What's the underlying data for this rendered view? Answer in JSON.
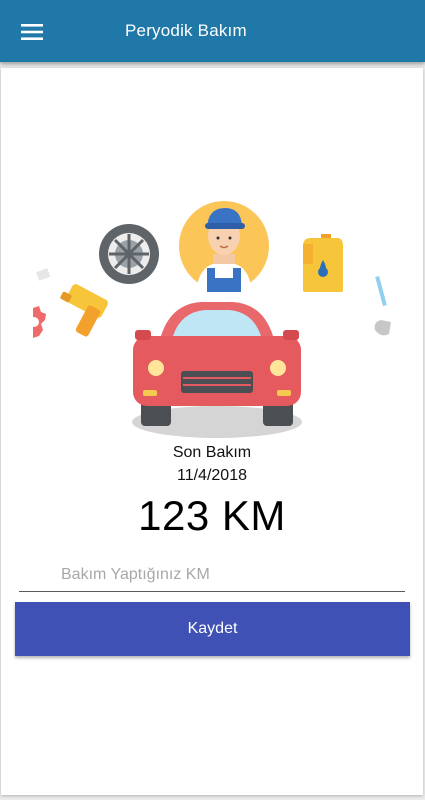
{
  "app_bar": {
    "title": "Peryodik Bakım",
    "menu_icon": "menu-icon",
    "color": "#1f78a8"
  },
  "illustration": {
    "icons": [
      "gear-icon",
      "spray-gun-icon",
      "tire-icon",
      "mechanic-icon",
      "oil-can-icon",
      "wrench-icon",
      "car-icon"
    ]
  },
  "maintenance": {
    "last_label": "Son Bakım",
    "last_date": "11/4/2018",
    "km_value": "123 KM"
  },
  "form": {
    "km_placeholder": "Bakım Yaptığınız KM",
    "save_label": "Kaydet",
    "button_color": "#3f51b5"
  }
}
